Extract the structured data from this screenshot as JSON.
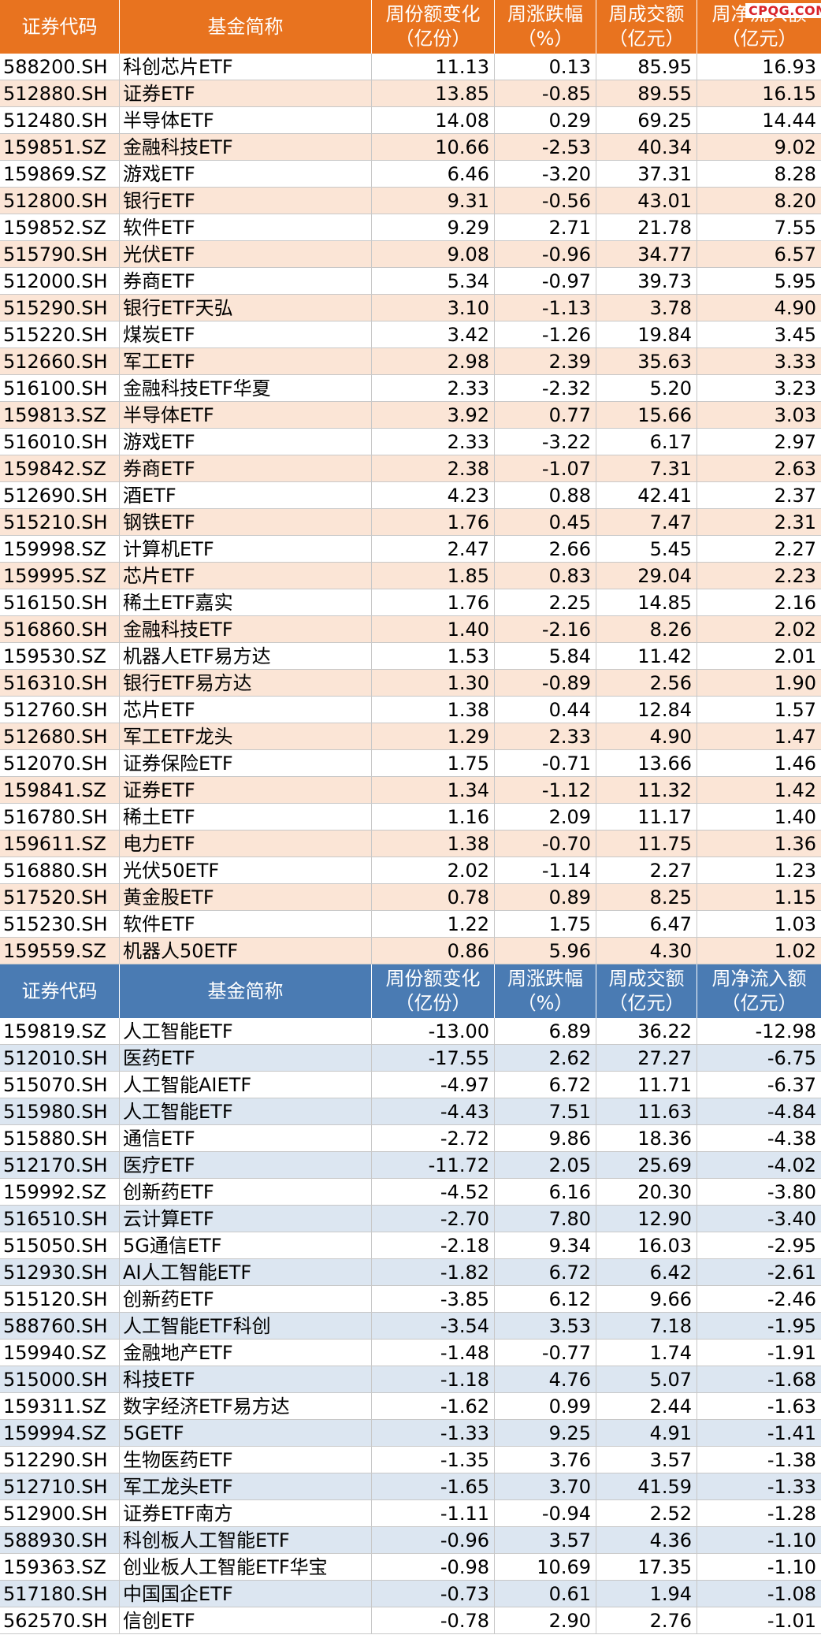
{
  "watermark": "CPQG.COM",
  "headers": [
    "证券代码",
    "基金简称",
    [
      "周份额变化",
      "（亿份）"
    ],
    [
      "周涨跌幅",
      "（%）"
    ],
    [
      "周成交额",
      "（亿元）"
    ],
    [
      "周净流入额",
      "（亿元）"
    ]
  ],
  "colors": {
    "inflow_header": "#E8731F",
    "inflow_alt_row": "#FBE5D6",
    "outflow_header": "#4A7BB3",
    "outflow_alt_row": "#DCE6F1"
  },
  "inflow": [
    [
      "588200.SH",
      "科创芯片ETF",
      "11.13",
      "0.13",
      "85.95",
      "16.93"
    ],
    [
      "512880.SH",
      "证券ETF",
      "13.85",
      "-0.85",
      "89.55",
      "16.15"
    ],
    [
      "512480.SH",
      "半导体ETF",
      "14.08",
      "0.29",
      "69.25",
      "14.44"
    ],
    [
      "159851.SZ",
      "金融科技ETF",
      "10.66",
      "-2.53",
      "40.34",
      "9.02"
    ],
    [
      "159869.SZ",
      "游戏ETF",
      "6.46",
      "-3.20",
      "37.31",
      "8.28"
    ],
    [
      "512800.SH",
      "银行ETF",
      "9.31",
      "-0.56",
      "43.01",
      "8.20"
    ],
    [
      "159852.SZ",
      "软件ETF",
      "9.29",
      "2.71",
      "21.78",
      "7.55"
    ],
    [
      "515790.SH",
      "光伏ETF",
      "9.08",
      "-0.96",
      "34.77",
      "6.57"
    ],
    [
      "512000.SH",
      "券商ETF",
      "5.34",
      "-0.97",
      "39.73",
      "5.95"
    ],
    [
      "515290.SH",
      "银行ETF天弘",
      "3.10",
      "-1.13",
      "3.78",
      "4.90"
    ],
    [
      "515220.SH",
      "煤炭ETF",
      "3.42",
      "-1.26",
      "19.84",
      "3.45"
    ],
    [
      "512660.SH",
      "军工ETF",
      "2.98",
      "2.39",
      "35.63",
      "3.33"
    ],
    [
      "516100.SH",
      "金融科技ETF华夏",
      "2.33",
      "-2.32",
      "5.20",
      "3.23"
    ],
    [
      "159813.SZ",
      "半导体ETF",
      "3.92",
      "0.77",
      "15.66",
      "3.03"
    ],
    [
      "516010.SH",
      "游戏ETF",
      "2.33",
      "-3.22",
      "6.17",
      "2.97"
    ],
    [
      "159842.SZ",
      "券商ETF",
      "2.38",
      "-1.07",
      "7.31",
      "2.63"
    ],
    [
      "512690.SH",
      "酒ETF",
      "4.23",
      "0.88",
      "42.41",
      "2.37"
    ],
    [
      "515210.SH",
      "钢铁ETF",
      "1.76",
      "0.45",
      "7.47",
      "2.31"
    ],
    [
      "159998.SZ",
      "计算机ETF",
      "2.47",
      "2.66",
      "5.45",
      "2.27"
    ],
    [
      "159995.SZ",
      "芯片ETF",
      "1.85",
      "0.83",
      "29.04",
      "2.23"
    ],
    [
      "516150.SH",
      "稀土ETF嘉实",
      "1.76",
      "2.25",
      "14.85",
      "2.16"
    ],
    [
      "516860.SH",
      "金融科技ETF",
      "1.40",
      "-2.16",
      "8.26",
      "2.02"
    ],
    [
      "159530.SZ",
      "机器人ETF易方达",
      "1.53",
      "5.84",
      "11.42",
      "2.01"
    ],
    [
      "516310.SH",
      "银行ETF易方达",
      "1.30",
      "-0.89",
      "2.56",
      "1.90"
    ],
    [
      "512760.SH",
      "芯片ETF",
      "1.38",
      "0.44",
      "12.84",
      "1.57"
    ],
    [
      "512680.SH",
      "军工ETF龙头",
      "1.29",
      "2.33",
      "4.90",
      "1.47"
    ],
    [
      "512070.SH",
      "证券保险ETF",
      "1.75",
      "-0.71",
      "13.66",
      "1.46"
    ],
    [
      "159841.SZ",
      "证券ETF",
      "1.34",
      "-1.12",
      "11.32",
      "1.42"
    ],
    [
      "516780.SH",
      "稀土ETF",
      "1.16",
      "2.09",
      "11.17",
      "1.40"
    ],
    [
      "159611.SZ",
      "电力ETF",
      "1.38",
      "-0.70",
      "11.75",
      "1.36"
    ],
    [
      "516880.SH",
      "光伏50ETF",
      "2.02",
      "-1.14",
      "2.27",
      "1.23"
    ],
    [
      "517520.SH",
      "黄金股ETF",
      "0.78",
      "0.89",
      "8.25",
      "1.15"
    ],
    [
      "515230.SH",
      "软件ETF",
      "1.22",
      "1.75",
      "6.47",
      "1.03"
    ],
    [
      "159559.SZ",
      "机器人50ETF",
      "0.86",
      "5.96",
      "4.30",
      "1.02"
    ]
  ],
  "outflow": [
    [
      "159819.SZ",
      "人工智能ETF",
      "-13.00",
      "6.89",
      "36.22",
      "-12.98"
    ],
    [
      "512010.SH",
      "医药ETF",
      "-17.55",
      "2.62",
      "27.27",
      "-6.75"
    ],
    [
      "515070.SH",
      "人工智能AIETF",
      "-4.97",
      "6.72",
      "11.71",
      "-6.37"
    ],
    [
      "515980.SH",
      "人工智能ETF",
      "-4.43",
      "7.51",
      "11.63",
      "-4.84"
    ],
    [
      "515880.SH",
      "通信ETF",
      "-2.72",
      "9.86",
      "18.36",
      "-4.38"
    ],
    [
      "512170.SH",
      "医疗ETF",
      "-11.72",
      "2.05",
      "25.69",
      "-4.02"
    ],
    [
      "159992.SZ",
      "创新药ETF",
      "-4.52",
      "6.16",
      "20.30",
      "-3.80"
    ],
    [
      "516510.SH",
      "云计算ETF",
      "-2.70",
      "7.80",
      "12.90",
      "-3.40"
    ],
    [
      "515050.SH",
      "5G通信ETF",
      "-2.18",
      "9.34",
      "16.03",
      "-2.95"
    ],
    [
      "512930.SH",
      "AI人工智能ETF",
      "-1.82",
      "6.72",
      "6.42",
      "-2.61"
    ],
    [
      "515120.SH",
      "创新药ETF",
      "-3.85",
      "6.12",
      "9.66",
      "-2.46"
    ],
    [
      "588760.SH",
      "人工智能ETF科创",
      "-3.54",
      "3.53",
      "7.18",
      "-1.95"
    ],
    [
      "159940.SZ",
      "金融地产ETF",
      "-1.48",
      "-0.77",
      "1.74",
      "-1.91"
    ],
    [
      "515000.SH",
      "科技ETF",
      "-1.18",
      "4.76",
      "5.07",
      "-1.68"
    ],
    [
      "159311.SZ",
      "数字经济ETF易方达",
      "-1.62",
      "0.99",
      "2.44",
      "-1.63"
    ],
    [
      "159994.SZ",
      "5GETF",
      "-1.33",
      "9.25",
      "4.91",
      "-1.41"
    ],
    [
      "512290.SH",
      "生物医药ETF",
      "-1.35",
      "3.76",
      "3.57",
      "-1.38"
    ],
    [
      "512710.SH",
      "军工龙头ETF",
      "-1.65",
      "3.70",
      "41.59",
      "-1.33"
    ],
    [
      "512900.SH",
      "证券ETF南方",
      "-1.11",
      "-0.94",
      "2.52",
      "-1.28"
    ],
    [
      "588930.SH",
      "科创板人工智能ETF",
      "-0.96",
      "3.57",
      "4.36",
      "-1.10"
    ],
    [
      "159363.SZ",
      "创业板人工智能ETF华宝",
      "-0.98",
      "10.69",
      "17.35",
      "-1.10"
    ],
    [
      "517180.SH",
      "中国国企ETF",
      "-0.73",
      "0.61",
      "1.94",
      "-1.08"
    ],
    [
      "562570.SH",
      "信创ETF",
      "-0.78",
      "2.90",
      "2.76",
      "-1.01"
    ]
  ]
}
